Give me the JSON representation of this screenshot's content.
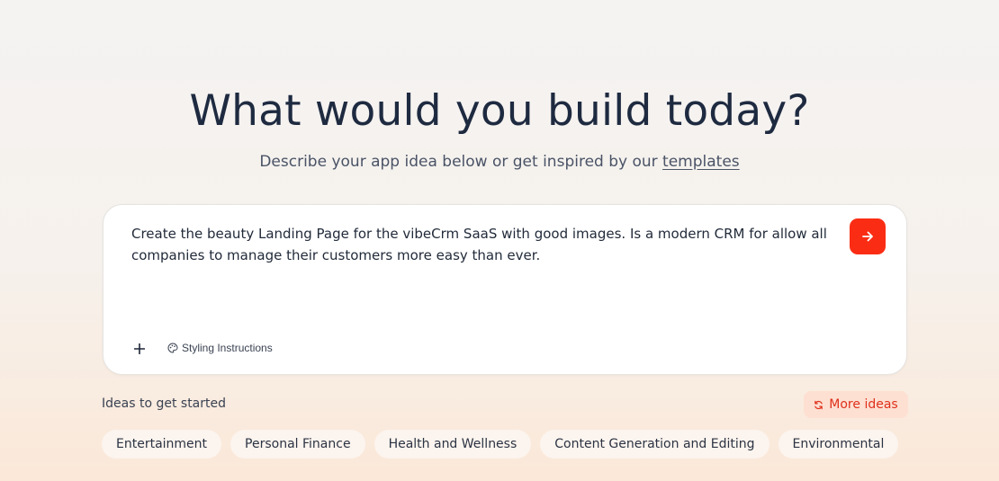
{
  "hero": {
    "title": "What would you build today?",
    "subtitle_prefix": "Describe your app idea below or get inspired by our ",
    "subtitle_link": "templates"
  },
  "composer": {
    "prompt_value": "Create the beauty Landing Page for the vibeCrm SaaS with good images. Is a modern CRM for allow all companies to manage their customers more easy than ever.",
    "send_icon": "arrow-right-icon",
    "add_icon": "plus-icon",
    "styling_label": "Styling Instructions",
    "styling_icon": "palette-icon"
  },
  "ideas": {
    "label": "Ideas to get started",
    "more_label": "More ideas",
    "more_icon": "refresh-icon",
    "chips": [
      "Entertainment",
      "Personal Finance",
      "Health and Wellness",
      "Content Generation and Editing",
      "Environmental"
    ]
  },
  "colors": {
    "accent": "#fa2d14",
    "accent_soft": "#fde0d2",
    "title": "#1e2a40"
  }
}
